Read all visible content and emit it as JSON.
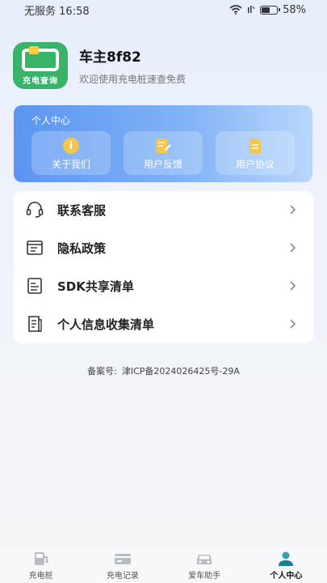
{
  "status_bar": {
    "carrier": "无服务",
    "time": "16:58",
    "battery": "58%"
  },
  "profile": {
    "logo_text": "充电查询",
    "user_name": "车主8f82",
    "welcome": "欢迎使用充电桩速查免费"
  },
  "personal_center": {
    "title": "个人中心",
    "tiles": [
      {
        "label": "关于我们",
        "icon": "info-icon"
      },
      {
        "label": "用户反馈",
        "icon": "feedback-icon"
      },
      {
        "label": "用户协议",
        "icon": "document-icon"
      }
    ]
  },
  "menu": {
    "items": [
      {
        "label": "联系客服",
        "icon": "headset-icon"
      },
      {
        "label": "隐私政策",
        "icon": "privacy-doc-icon"
      },
      {
        "label": "SDK共享清单",
        "icon": "list-doc-icon"
      },
      {
        "label": "个人信息收集清单",
        "icon": "info-list-icon"
      }
    ]
  },
  "beian": {
    "prefix": "备案号:",
    "number": "津ICP备2024026425号-29A"
  },
  "tabbar": {
    "tabs": [
      {
        "label": "充电桩",
        "icon": "charger-icon"
      },
      {
        "label": "充电记录",
        "icon": "record-icon"
      },
      {
        "label": "爱车助手",
        "icon": "car-icon"
      },
      {
        "label": "个人中心",
        "icon": "person-icon"
      }
    ],
    "active_index": 3
  },
  "colors": {
    "accent_blue": "#5b95f2",
    "logo_green": "#3ab36a",
    "info_yellow": "#f6c64a"
  }
}
